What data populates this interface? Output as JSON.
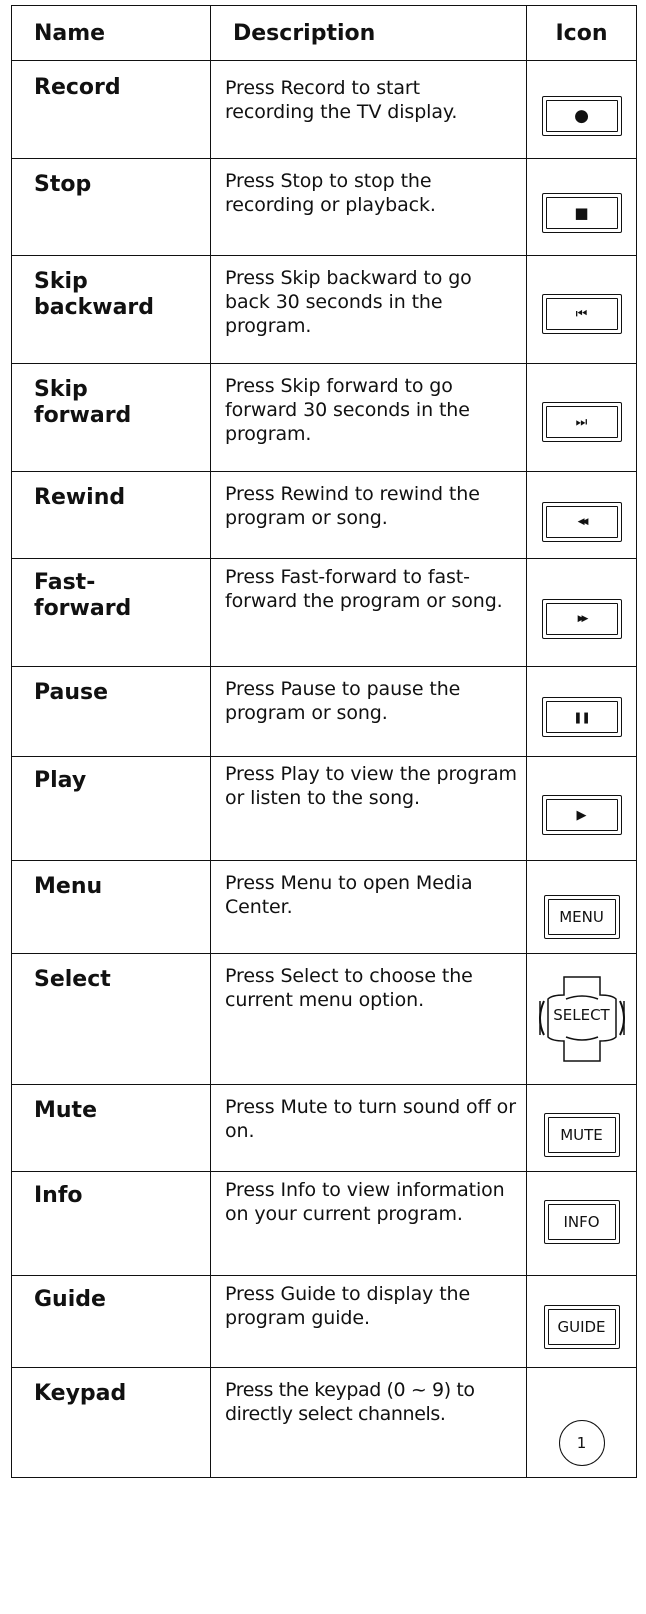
{
  "header": {
    "name": "Name",
    "description": "Description",
    "icon": "Icon"
  },
  "rows": [
    {
      "name": "Record",
      "description": "Press Record to start recording the TV display.",
      "icon": "record-icon",
      "glyph": "●"
    },
    {
      "name": "Stop",
      "description": "Press Stop to stop the recording or playback.",
      "icon": "stop-icon",
      "glyph": "■"
    },
    {
      "name": "Skip backward",
      "description": "Press Skip backward to go back 30 seconds in the program.",
      "icon": "skip-backward-icon",
      "glyph": "⏮"
    },
    {
      "name": "Skip forward",
      "description": "Press Skip forward to go forward 30 seconds in the program.",
      "icon": "skip-forward-icon",
      "glyph": "⏭"
    },
    {
      "name": "Rewind",
      "description": "Press Rewind to rewind the program or song.",
      "icon": "rewind-icon",
      "glyph": "◀◀"
    },
    {
      "name": "Fast-forward",
      "description": "Press Fast-forward to fast-forward the program or song.",
      "icon": "fast-forward-icon",
      "glyph": "▶▶"
    },
    {
      "name": "Pause",
      "description": "Press Pause to pause the program or song.",
      "icon": "pause-icon",
      "glyph": "❚❚"
    },
    {
      "name": "Play",
      "description": "Press Play to view the program or listen to the song.",
      "icon": "play-icon",
      "glyph": "▶"
    },
    {
      "name": "Menu",
      "description": "Press Menu to open Media Center.",
      "icon": "menu-button-icon",
      "label": "MENU"
    },
    {
      "name": "Select",
      "description": "Press Select to choose the current menu option.",
      "icon": "select-dpad-icon",
      "label": "SELECT"
    },
    {
      "name": "Mute",
      "description": "Press Mute to turn sound off or on.",
      "icon": "mute-button-icon",
      "label": "MUTE"
    },
    {
      "name": "Info",
      "description": "Press Info to view information on your current program.",
      "icon": "info-button-icon",
      "label": "INFO"
    },
    {
      "name": "Guide",
      "description": "Press Guide to display the program guide.",
      "icon": "guide-button-icon",
      "label": "GUIDE"
    },
    {
      "name": "Keypad",
      "description": "Press the keypad (0 ~ 9) to directly select channels.",
      "icon": "keypad-key-icon",
      "label": "1"
    }
  ]
}
